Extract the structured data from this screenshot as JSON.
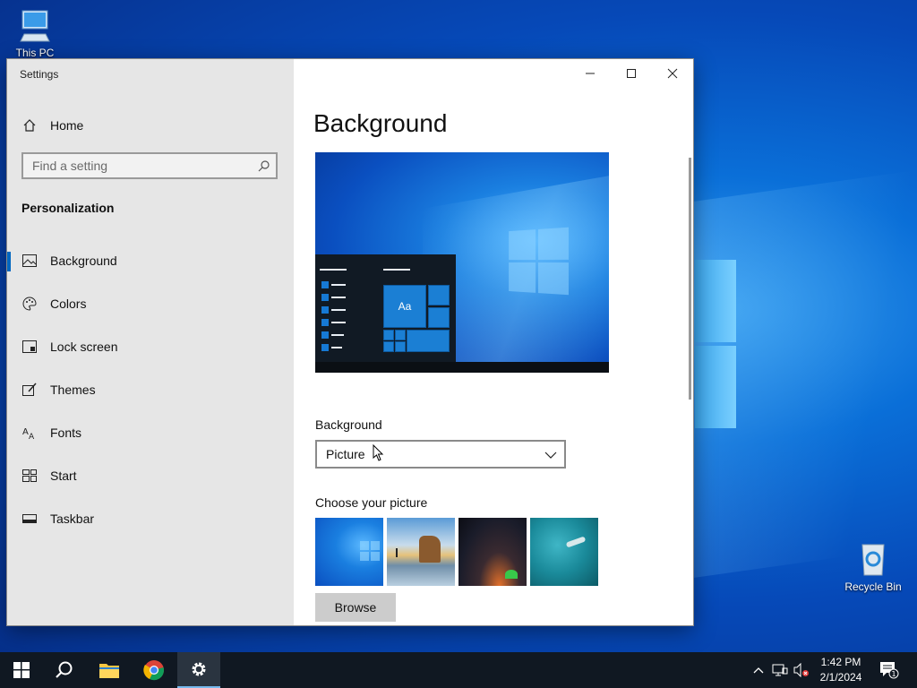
{
  "desktop": {
    "this_pc_label": "This PC",
    "recycle_bin_label": "Recycle Bin"
  },
  "window": {
    "title": "Settings"
  },
  "sidebar": {
    "home_label": "Home",
    "search_placeholder": "Find a setting",
    "section_title": "Personalization",
    "items": [
      {
        "label": "Background",
        "icon": "picture-icon",
        "active": true
      },
      {
        "label": "Colors",
        "icon": "palette-icon"
      },
      {
        "label": "Lock screen",
        "icon": "lock-screen-icon"
      },
      {
        "label": "Themes",
        "icon": "themes-icon"
      },
      {
        "label": "Fonts",
        "icon": "fonts-icon"
      },
      {
        "label": "Start",
        "icon": "start-icon"
      },
      {
        "label": "Taskbar",
        "icon": "taskbar-icon"
      }
    ]
  },
  "main": {
    "page_title": "Background",
    "preview_tile_text": "Aa",
    "background_label": "Background",
    "background_value": "Picture",
    "choose_picture_label": "Choose your picture",
    "browse_label": "Browse"
  },
  "taskbar": {
    "time": "1:42 PM",
    "date": "2/1/2024",
    "notification_count": "1"
  },
  "colors": {
    "accent": "#0067c0",
    "sidebar_bg": "#e6e6e6",
    "taskbar_bg": "#101822"
  }
}
